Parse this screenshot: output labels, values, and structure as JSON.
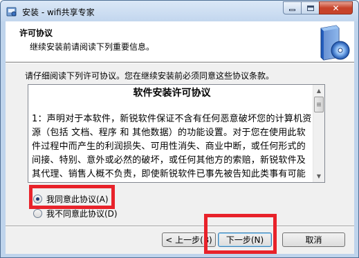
{
  "window": {
    "title": "安装 - wifi共享专家",
    "minimize_icon": "minimize-icon",
    "maximize_icon": "maximize-icon",
    "close_icon": "close-icon",
    "close_glyph": "✕"
  },
  "header": {
    "title": "许可协议",
    "subtitle": "继续安装前请阅读下列重要信息。",
    "graphic_icon": "setup-disc-icon"
  },
  "instruction": "请仔细阅读下列许可协议。您在继续安装前必须同意这些协议条款。",
  "license": {
    "heading": "软件安装许可协议",
    "paragraph": "1：声明对于本软件，新锐软件保证不含有任何恶意破坏您的计算机资源（包括 文档、程序 和 其他数据）的功能设置。对于您在使用此软件过程中而产生的利润损失、可用性消失、商业中断，或任何形式的间接、特别、意外或必然的破坏，或任何其他方的索赔，新锐软件及其代理、销售人概不负责，即使新锐软件已事先被告知此类事有可能发生。"
  },
  "scrollbar": {
    "up_glyph": "▲",
    "down_glyph": "▼"
  },
  "options": {
    "accept_label": "我同意此协议(A)",
    "decline_label": "我不同意此协议(D)",
    "selected": "accept"
  },
  "buttons": {
    "back": "< 上一步(B)",
    "next": "下一步(N)",
    "cancel": "取消"
  },
  "colors": {
    "highlight": "#e8222a",
    "title_bar": "#c2d6ee",
    "close_button": "#c7432a"
  }
}
